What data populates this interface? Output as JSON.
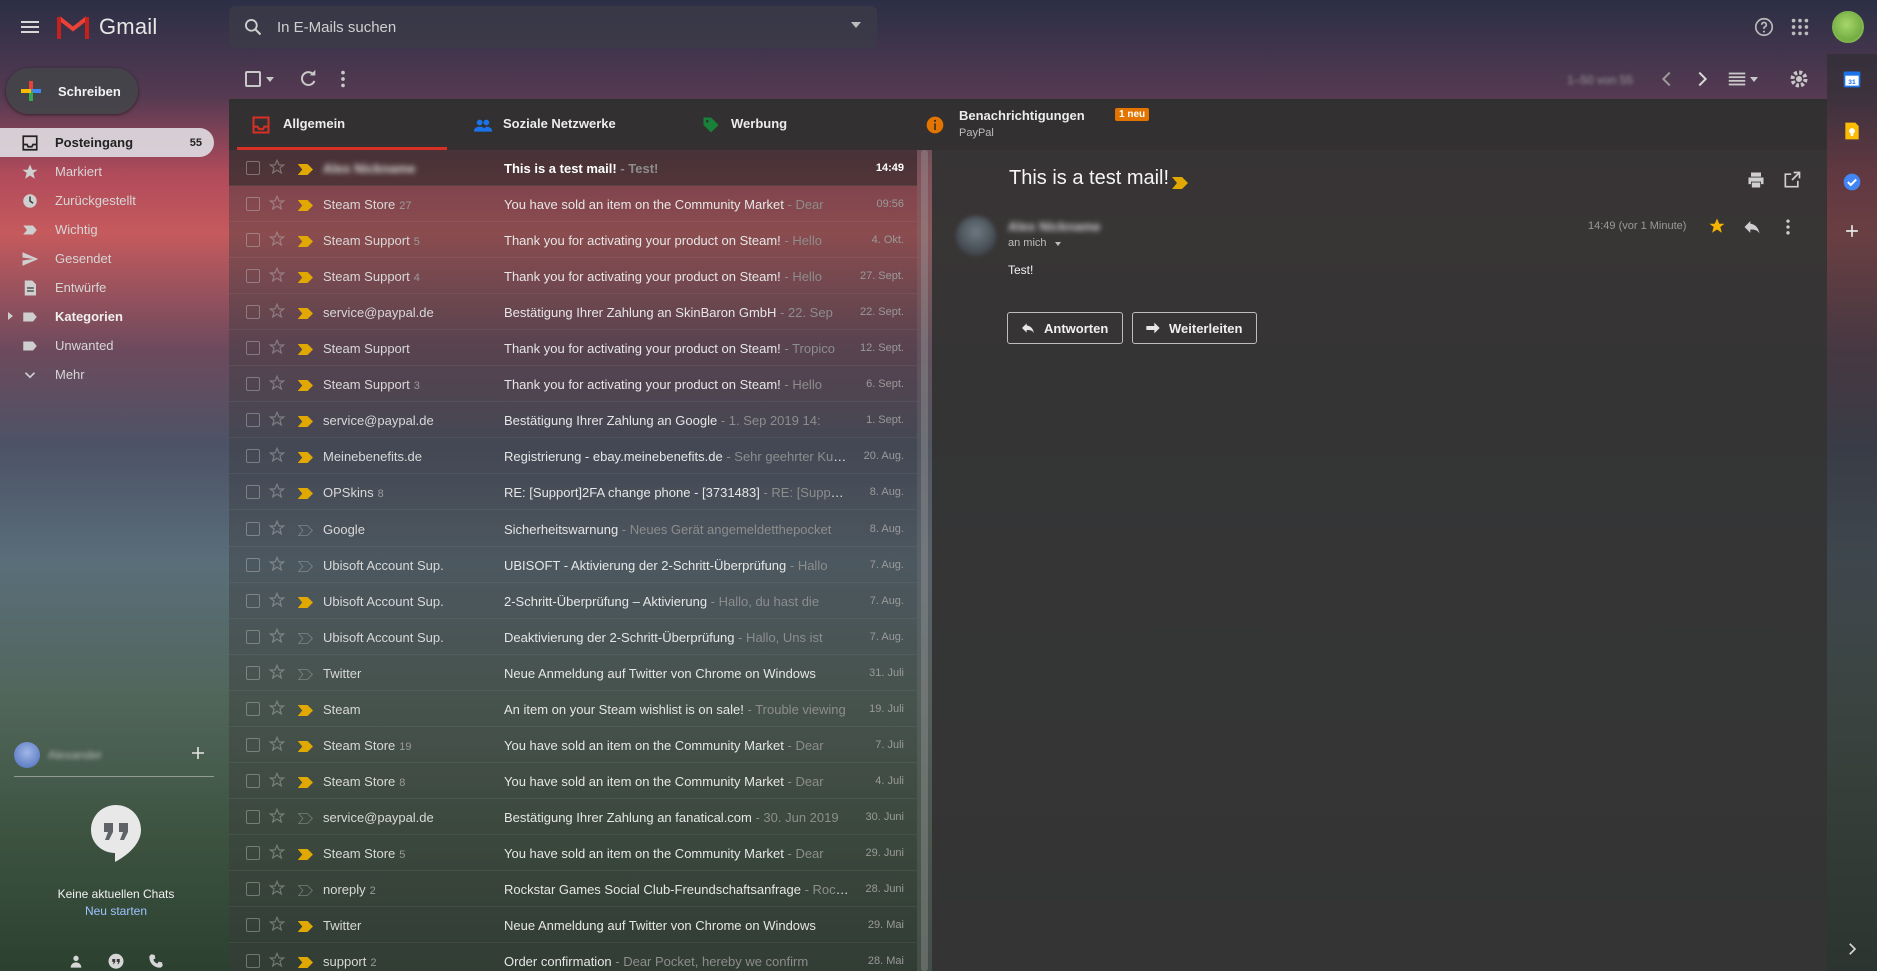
{
  "app": {
    "name": "Gmail"
  },
  "search": {
    "placeholder": "In E-Mails suchen"
  },
  "compose": {
    "label": "Schreiben"
  },
  "nav": {
    "items": [
      {
        "label": "Posteingang",
        "count": "55",
        "icon": "inbox-icon"
      },
      {
        "label": "Markiert",
        "count": "",
        "icon": "star-icon"
      },
      {
        "label": "Zurückgestellt",
        "count": "",
        "icon": "clock-icon"
      },
      {
        "label": "Wichtig",
        "count": "",
        "icon": "important-icon"
      },
      {
        "label": "Gesendet",
        "count": "",
        "icon": "send-icon"
      },
      {
        "label": "Entwürfe",
        "count": "",
        "icon": "draft-icon"
      },
      {
        "label": "Kategorien",
        "count": "",
        "icon": "label-icon"
      },
      {
        "label": "Unwanted",
        "count": "",
        "icon": "label-icon"
      },
      {
        "label": "Mehr",
        "count": "",
        "icon": "chevron-down-icon"
      }
    ]
  },
  "hangouts": {
    "user_name": "Alexander",
    "empty_text": "Keine aktuellen Chats",
    "start_link": "Neu starten"
  },
  "toolbar": {
    "page_info": "1–50 von 55"
  },
  "tabs": [
    {
      "label": "Allgemein",
      "color": "#d93025"
    },
    {
      "label": "Soziale Netzwerke",
      "color": "#1a73e8"
    },
    {
      "label": "Werbung",
      "color": "#188038"
    },
    {
      "label": "Benachrichtigungen",
      "badge": "1 neu",
      "sub": "PayPal",
      "color": "#e37400"
    }
  ],
  "emails": [
    {
      "sender": "Alex Nickname",
      "count": "",
      "subject": "This is a test mail!",
      "snippet": " - Test!",
      "date": "14:49",
      "important": true,
      "unread": true,
      "selected": true,
      "blurred": true
    },
    {
      "sender": "Steam Store",
      "count": "27",
      "subject": "You have sold an item on the Community Market",
      "snippet": " - Dear",
      "date": "09:56",
      "important": true
    },
    {
      "sender": "Steam Support",
      "count": "5",
      "subject": "Thank you for activating your product on Steam!",
      "snippet": " - Hello",
      "date": "4. Okt.",
      "important": true
    },
    {
      "sender": "Steam Support",
      "count": "4",
      "subject": "Thank you for activating your product on Steam!",
      "snippet": " - Hello",
      "date": "27. Sept.",
      "important": true
    },
    {
      "sender": "service@paypal.de",
      "count": "",
      "subject": "Bestätigung Ihrer Zahlung an SkinBaron GmbH",
      "snippet": " - 22. Sep",
      "date": "22. Sept.",
      "important": true
    },
    {
      "sender": "Steam Support",
      "count": "",
      "subject": "Thank you for activating your product on Steam!",
      "snippet": " - Tropico",
      "date": "12. Sept.",
      "important": true
    },
    {
      "sender": "Steam Support",
      "count": "3",
      "subject": "Thank you for activating your product on Steam!",
      "snippet": " - Hello",
      "date": "6. Sept.",
      "important": true
    },
    {
      "sender": "service@paypal.de",
      "count": "",
      "subject": "Bestätigung Ihrer Zahlung an Google",
      "snippet": " - 1. Sep 2019 14:",
      "date": "1. Sept.",
      "important": true
    },
    {
      "sender": "Meinebenefits.de",
      "count": "",
      "subject": "Registrierung - ebay.meinebenefits.de",
      "snippet": " - Sehr geehrter Kunde",
      "date": "20. Aug.",
      "important": true
    },
    {
      "sender": "OPSkins",
      "count": "8",
      "subject": "RE: [Support]2FA change phone - [3731483]",
      "snippet": " - RE: [Support]",
      "date": "8. Aug.",
      "important": true
    },
    {
      "sender": "Google",
      "count": "",
      "subject": "Sicherheitswarnung",
      "snippet": " - Neues Gerät angemeldetthepocket",
      "date": "8. Aug.",
      "important": false
    },
    {
      "sender": "Ubisoft Account Sup.",
      "count": "",
      "subject": "UBISOFT - Aktivierung der 2-Schritt-Überprüfung",
      "snippet": " - Hallo",
      "date": "7. Aug.",
      "important": false
    },
    {
      "sender": "Ubisoft Account Sup.",
      "count": "",
      "subject": "2-Schritt-Überprüfung – Aktivierung",
      "snippet": " - Hallo, du hast die",
      "date": "7. Aug.",
      "important": true
    },
    {
      "sender": "Ubisoft Account Sup.",
      "count": "",
      "subject": "Deaktivierung der 2-Schritt-Überprüfung",
      "snippet": " - Hallo, Uns ist",
      "date": "7. Aug.",
      "important": false
    },
    {
      "sender": "Twitter",
      "count": "",
      "subject": "Neue Anmeldung auf Twitter von Chrome on Windows",
      "snippet": "",
      "date": "31. Juli",
      "important": false
    },
    {
      "sender": "Steam",
      "count": "",
      "subject": "An item on your Steam wishlist is on sale!",
      "snippet": " - Trouble viewing",
      "date": "19. Juli",
      "important": true
    },
    {
      "sender": "Steam Store",
      "count": "19",
      "subject": "You have sold an item on the Community Market",
      "snippet": " - Dear",
      "date": "7. Juli",
      "important": true
    },
    {
      "sender": "Steam Store",
      "count": "8",
      "subject": "You have sold an item on the Community Market",
      "snippet": " - Dear",
      "date": "4. Juli",
      "important": true
    },
    {
      "sender": "service@paypal.de",
      "count": "",
      "subject": "Bestätigung Ihrer Zahlung an fanatical.com",
      "snippet": " - 30. Jun 2019",
      "date": "30. Juni",
      "important": false
    },
    {
      "sender": "Steam Store",
      "count": "5",
      "subject": "You have sold an item on the Community Market",
      "snippet": " - Dear",
      "date": "29. Juni",
      "important": true
    },
    {
      "sender": "noreply",
      "count": "2",
      "subject": "Rockstar Games Social Club-Freundschaftsanfrage",
      "snippet": " - Rockstar",
      "date": "28. Juni",
      "important": false
    },
    {
      "sender": "Twitter",
      "count": "",
      "subject": "Neue Anmeldung auf Twitter von Chrome on Windows",
      "snippet": "",
      "date": "29. Mai",
      "important": true
    },
    {
      "sender": "support",
      "count": "2",
      "subject": "Order confirmation",
      "snippet": " - Dear Pocket, hereby we confirm",
      "date": "28. Mai",
      "important": true
    }
  ],
  "reader": {
    "title": "This is a test mail!",
    "sender": "Alex Nickname",
    "recipient": "an mich",
    "time": "14:49 (vor 1 Minute)",
    "body": "Test!",
    "reply_label": "Antworten",
    "forward_label": "Weiterleiten"
  },
  "colors": {
    "important": "#e0a800",
    "star_active": "#f4b400",
    "link": "#9ec3ff"
  }
}
